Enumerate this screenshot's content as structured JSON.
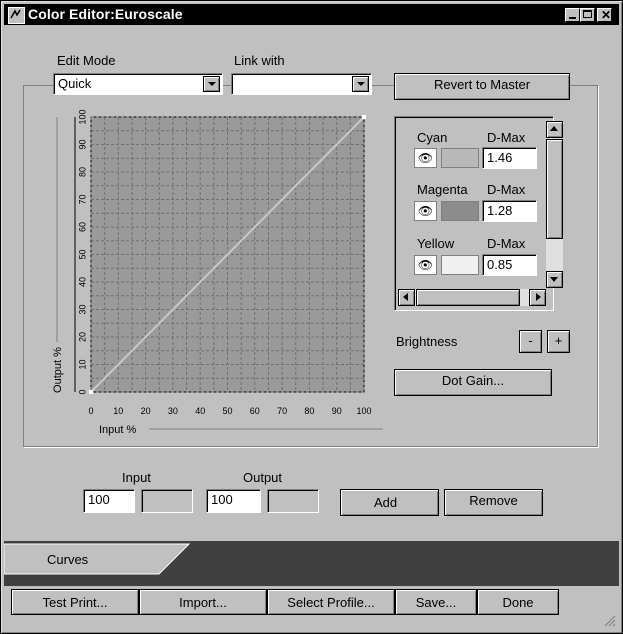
{
  "window": {
    "title": "Color Editor:Euroscale"
  },
  "edit_mode": {
    "label": "Edit Mode",
    "value": "Quick"
  },
  "link_with": {
    "label": "Link with",
    "value": ""
  },
  "revert_button": "Revert to Master",
  "chart_data": {
    "type": "line",
    "xlabel": "Input %",
    "ylabel": "Output %",
    "xlim": [
      0,
      100
    ],
    "ylim": [
      0,
      100
    ],
    "x_ticks": [
      "0",
      "10",
      "20",
      "30",
      "40",
      "50",
      "60",
      "70",
      "80",
      "90",
      "100"
    ],
    "y_ticks": [
      "0",
      "10",
      "20",
      "30",
      "40",
      "50",
      "60",
      "70",
      "80",
      "90",
      "100"
    ],
    "grid": true,
    "series": [
      {
        "x": [
          0,
          100
        ],
        "y": [
          0,
          100
        ]
      }
    ]
  },
  "inks": [
    {
      "name": "Cyan",
      "dmax_label": "D-Max",
      "dmax": "1.46",
      "color": "#b8b8b8"
    },
    {
      "name": "Magenta",
      "dmax_label": "D-Max",
      "dmax": "1.28",
      "color": "#8c8c8c"
    },
    {
      "name": "Yellow",
      "dmax_label": "D-Max",
      "dmax": "0.85",
      "color": "#f0f0f0"
    }
  ],
  "brightness": {
    "label": "Brightness",
    "minus": "-",
    "plus": "+"
  },
  "dot_gain_button": "Dot Gain...",
  "point": {
    "input_label": "Input",
    "input_value": "100",
    "output_label": "Output",
    "output_value": "100"
  },
  "add_button": "Add",
  "remove_button": "Remove",
  "tabs": [
    {
      "label": "Curves"
    }
  ],
  "footer_buttons": [
    "Test Print...",
    "Import...",
    "Select Profile...",
    "Save...",
    "Done"
  ],
  "colors": {
    "plot_bg": "#9a9a9a",
    "grid": "#707070",
    "curve": "#c8c8c8",
    "tab_strip": "#404040"
  }
}
